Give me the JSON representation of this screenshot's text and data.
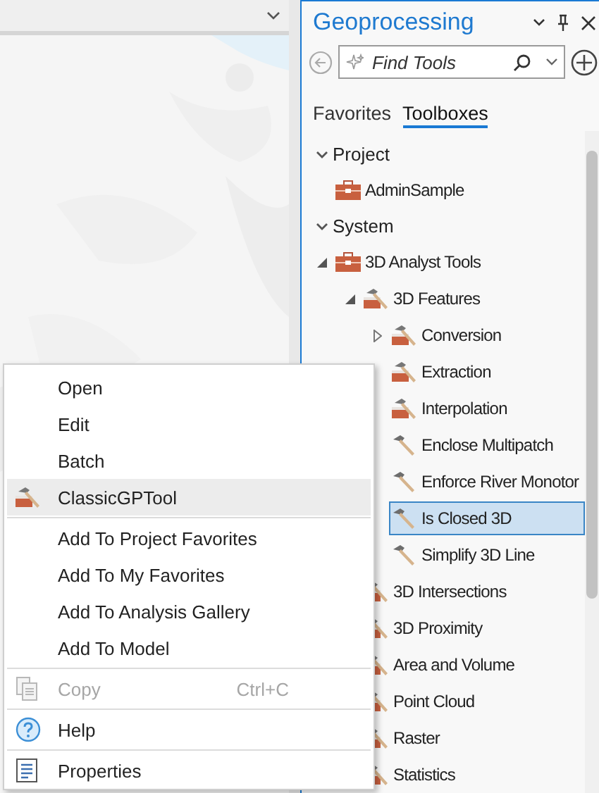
{
  "panel": {
    "title": "Geoprocessing"
  },
  "search": {
    "placeholder": "Find Tools"
  },
  "tabs": [
    {
      "label": "Favorites",
      "selected": false
    },
    {
      "label": "Toolboxes",
      "selected": true
    }
  ],
  "tree": [
    {
      "label": "Project",
      "kind": "section",
      "expanded": true,
      "children": [
        {
          "label": "AdminSample",
          "kind": "toolbox",
          "selected": false
        }
      ]
    },
    {
      "label": "System",
      "kind": "section",
      "expanded": true,
      "children": [
        {
          "label": "3D Analyst Tools",
          "kind": "toolbox",
          "expanded": true,
          "selected": false,
          "children": [
            {
              "label": "3D Features",
              "kind": "toolset",
              "expanded": true,
              "selected": false,
              "children": [
                {
                  "label": "Conversion",
                  "kind": "toolset",
                  "expanded": false,
                  "selected": false
                },
                {
                  "label": "Extraction",
                  "kind": "toolset",
                  "selected": false
                },
                {
                  "label": "Interpolation",
                  "kind": "toolset",
                  "selected": false
                },
                {
                  "label": "Enclose Multipatch",
                  "kind": "tool",
                  "selected": false
                },
                {
                  "label": "Enforce River Monotor",
                  "kind": "tool",
                  "selected": false
                },
                {
                  "label": "Is Closed 3D",
                  "kind": "tool",
                  "selected": true
                },
                {
                  "label": "Simplify 3D Line",
                  "kind": "tool",
                  "selected": false
                }
              ]
            },
            {
              "label": "3D Intersections",
              "kind": "toolset",
              "selected": false
            },
            {
              "label": "3D Proximity",
              "kind": "toolset",
              "selected": false
            },
            {
              "label": "Area and Volume",
              "kind": "toolset",
              "selected": false
            },
            {
              "label": "Point Cloud",
              "kind": "toolset",
              "selected": false
            },
            {
              "label": "Raster",
              "kind": "toolset",
              "selected": false
            },
            {
              "label": "Statistics",
              "kind": "toolset",
              "selected": false
            }
          ]
        }
      ]
    }
  ],
  "context_menu": {
    "groups": [
      [
        {
          "label": "Open",
          "kind": "plain",
          "highlighted": false,
          "disabled": false
        },
        {
          "label": "Edit",
          "kind": "plain",
          "highlighted": false,
          "disabled": false
        },
        {
          "label": "Batch",
          "kind": "plain",
          "highlighted": false,
          "disabled": false
        },
        {
          "label": "ClassicGPTool",
          "kind": "toolset",
          "highlighted": true,
          "disabled": false
        }
      ],
      [
        {
          "label": "Add To Project Favorites",
          "kind": "plain",
          "highlighted": false,
          "disabled": false
        },
        {
          "label": "Add To My Favorites",
          "kind": "plain",
          "highlighted": false,
          "disabled": false
        },
        {
          "label": "Add To Analysis Gallery",
          "kind": "plain",
          "highlighted": false,
          "disabled": false
        },
        {
          "label": "Add To Model",
          "kind": "plain",
          "highlighted": false,
          "disabled": false
        }
      ],
      [
        {
          "label": "Copy",
          "kind": "copy",
          "highlighted": false,
          "disabled": true,
          "shortcut": "Ctrl+C"
        }
      ],
      [
        {
          "label": "Help",
          "kind": "help",
          "highlighted": false,
          "disabled": false
        }
      ],
      [
        {
          "label": "Properties",
          "kind": "properties",
          "highlighted": false,
          "disabled": false
        }
      ]
    ]
  }
}
